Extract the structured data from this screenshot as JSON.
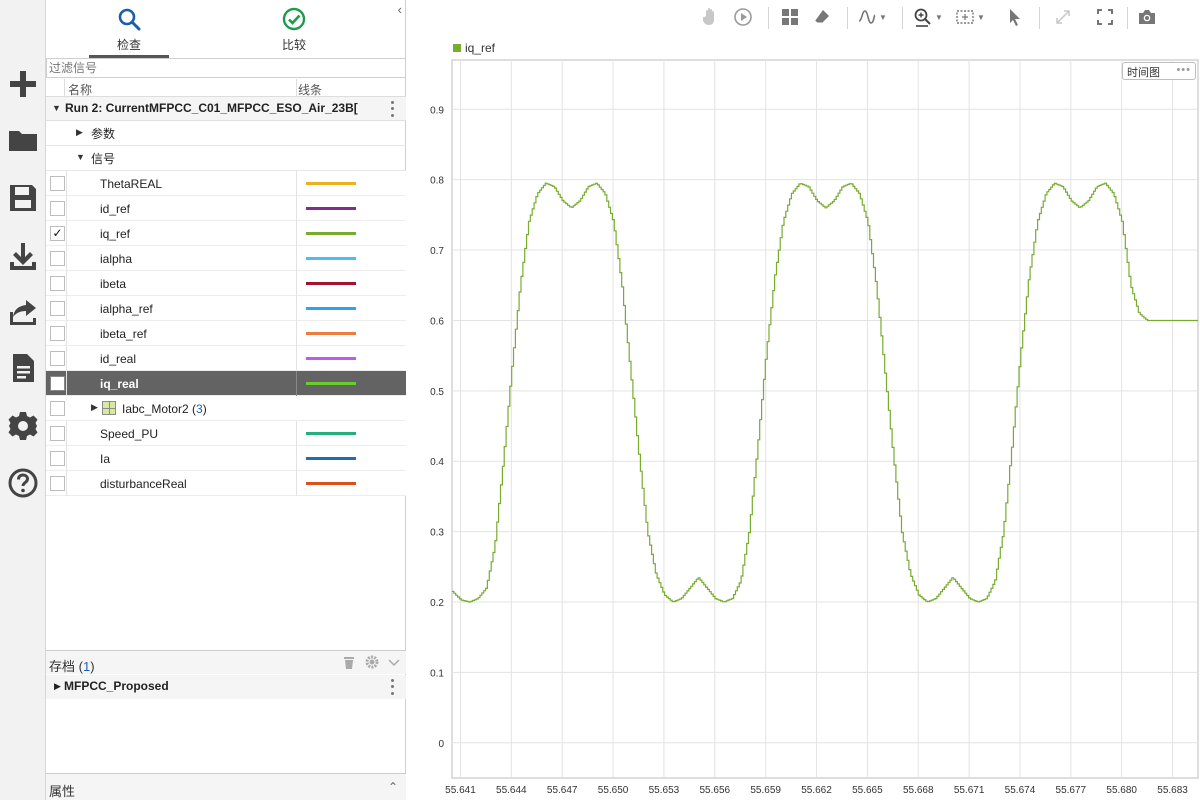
{
  "rail": {
    "icons": [
      "plus-icon",
      "folder-icon",
      "save-icon",
      "download-icon",
      "share-icon",
      "document-icon",
      "gear-icon",
      "help-icon"
    ]
  },
  "panel": {
    "tabs": [
      {
        "label": "检查",
        "icon": "magnifier-icon",
        "active": true
      },
      {
        "label": "比较",
        "icon": "check-circle-icon",
        "active": false
      }
    ],
    "collapse_glyph": "‹",
    "filter_placeholder": "过滤信号",
    "columns": {
      "name": "名称",
      "line": "线条"
    },
    "run": {
      "label": "Run 2: CurrentMFPCC_C01_MFPCC_ESO_Air_23B["
    },
    "groups": {
      "params": "参数",
      "signals": "信号"
    },
    "signals": [
      {
        "name": "ThetaREAL",
        "color": "#EDB120",
        "checked": false,
        "selected": false
      },
      {
        "name": "id_ref",
        "color": "#7E2F8E",
        "checked": false,
        "selected": false
      },
      {
        "name": "iq_ref",
        "color": "#77AC30",
        "checked": true,
        "selected": false
      },
      {
        "name": "ialpha",
        "color": "#4DBEEE",
        "checked": false,
        "selected": false
      },
      {
        "name": "ibeta",
        "color": "#A2142F",
        "checked": false,
        "selected": false
      },
      {
        "name": "ialpha_ref",
        "color": "#2EA3F5",
        "checked": false,
        "selected": false
      },
      {
        "name": "ibeta_ref",
        "color": "#F07B3F",
        "checked": false,
        "selected": false
      },
      {
        "name": "id_real",
        "color": "#B95CF0",
        "checked": false,
        "selected": false
      },
      {
        "name": "iq_real",
        "color": "#6ACD2E",
        "checked": false,
        "selected": true
      },
      {
        "name": "Speed_PU",
        "color": "#23B07D",
        "checked": false,
        "selected": false
      },
      {
        "name": "Ia",
        "color": "#1F6FB0",
        "checked": false,
        "selected": false
      },
      {
        "name": "disturbanceReal",
        "color": "#D95319",
        "checked": false,
        "selected": false
      }
    ],
    "bus": {
      "name": "Iabc_Motor2",
      "count_open": " (",
      "count": "3",
      "count_close": ")"
    },
    "archive": {
      "title": "存档",
      "count_open": " (",
      "count": "1",
      "count_close": ")",
      "item": "MFPCC_Proposed"
    },
    "properties": {
      "title": "属性",
      "chev": "⌃"
    }
  },
  "plot": {
    "legend": {
      "label": "iq_ref",
      "color": "#77AC30"
    },
    "view_tag": "时间图",
    "view_tag_dots": "•••",
    "toolbar_icons": [
      "hand-icon",
      "play-icon",
      "layout-grid-icon",
      "eraser-icon",
      "wave-icon",
      "zoom-icon",
      "fit-icon",
      "cursor-icon",
      "expand-icon",
      "fullscreen-icon",
      "camera-icon"
    ]
  },
  "chart_data": {
    "type": "line",
    "title": "",
    "xlabel": "",
    "ylabel": "",
    "xlim": [
      55.6405,
      55.6845
    ],
    "ylim": [
      -0.05,
      0.97
    ],
    "grid": true,
    "x_ticks": [
      "55.641",
      "55.644",
      "55.647",
      "55.650",
      "55.653",
      "55.656",
      "55.659",
      "55.662",
      "55.665",
      "55.668",
      "55.671",
      "55.674",
      "55.677",
      "55.680",
      "55.683"
    ],
    "y_ticks": [
      "0",
      "0.1",
      "0.2",
      "0.3",
      "0.4",
      "0.5",
      "0.6",
      "0.7",
      "0.8",
      "0.9"
    ],
    "series": [
      {
        "name": "iq_ref",
        "color": "#77AC30",
        "x": [
          55.6405,
          55.641,
          55.6415,
          55.642,
          55.6425,
          55.643,
          55.6435,
          55.644,
          55.6445,
          55.645,
          55.6455,
          55.646,
          55.6465,
          55.647,
          55.6475,
          55.648,
          55.6485,
          55.649,
          55.6495,
          55.65,
          55.6505,
          55.651,
          55.6515,
          55.652,
          55.6525,
          55.653,
          55.6535,
          55.654,
          55.6545,
          55.655,
          55.6555,
          55.656,
          55.6565,
          55.657,
          55.6575,
          55.658,
          55.6585,
          55.659,
          55.6595,
          55.66,
          55.6605,
          55.661,
          55.6615,
          55.662,
          55.6625,
          55.663,
          55.6635,
          55.664,
          55.6645,
          55.665,
          55.6655,
          55.666,
          55.6665,
          55.667,
          55.6675,
          55.668,
          55.6685,
          55.669,
          55.6695,
          55.67,
          55.6705,
          55.671,
          55.6715,
          55.672,
          55.6725,
          55.673,
          55.6735,
          55.674,
          55.6745,
          55.675,
          55.6755,
          55.676,
          55.6765,
          55.677,
          55.6775,
          55.678,
          55.6785,
          55.679,
          55.6795,
          55.68,
          55.6805,
          55.681,
          55.6815,
          55.682,
          55.6825,
          55.683,
          55.6835,
          55.684,
          55.6845
        ],
        "y": [
          0.215,
          0.203,
          0.2,
          0.205,
          0.22,
          0.28,
          0.4,
          0.53,
          0.65,
          0.74,
          0.78,
          0.795,
          0.79,
          0.77,
          0.76,
          0.77,
          0.79,
          0.795,
          0.78,
          0.74,
          0.65,
          0.53,
          0.41,
          0.3,
          0.24,
          0.21,
          0.2,
          0.205,
          0.22,
          0.235,
          0.22,
          0.205,
          0.2,
          0.205,
          0.23,
          0.3,
          0.42,
          0.55,
          0.66,
          0.74,
          0.78,
          0.795,
          0.79,
          0.77,
          0.76,
          0.77,
          0.79,
          0.795,
          0.78,
          0.74,
          0.65,
          0.53,
          0.41,
          0.3,
          0.24,
          0.21,
          0.2,
          0.205,
          0.22,
          0.235,
          0.22,
          0.205,
          0.2,
          0.205,
          0.23,
          0.3,
          0.42,
          0.55,
          0.66,
          0.74,
          0.78,
          0.795,
          0.79,
          0.77,
          0.76,
          0.77,
          0.79,
          0.795,
          0.78,
          0.74,
          0.65,
          0.61,
          0.6,
          0.6,
          0.6,
          0.6,
          0.6,
          0.6,
          0.6
        ]
      }
    ]
  }
}
